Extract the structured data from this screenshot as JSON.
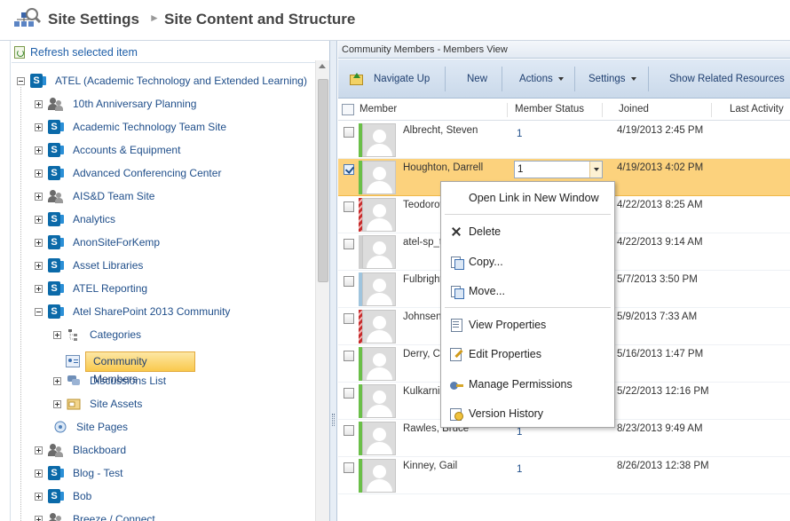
{
  "header": {
    "title": "Site Settings",
    "subtitle": "Site Content and Structure"
  },
  "left": {
    "refresh": "Refresh selected item",
    "root": "ATEL (Academic Technology and Extended Learning)",
    "sites": [
      {
        "label": "10th Anniversary Planning",
        "icon": "group-icon"
      },
      {
        "label": "Academic Technology Team Site",
        "icon": "sharepoint-icon"
      },
      {
        "label": "Accounts & Equipment",
        "icon": "sharepoint-icon"
      },
      {
        "label": "Advanced Conferencing Center",
        "icon": "sharepoint-icon"
      },
      {
        "label": "AIS&D Team Site",
        "icon": "group-icon"
      },
      {
        "label": "Analytics",
        "icon": "sharepoint-icon"
      },
      {
        "label": "AnonSiteForKemp",
        "icon": "sharepoint-icon"
      },
      {
        "label": "Asset Libraries",
        "icon": "sharepoint-icon"
      },
      {
        "label": "ATEL Reporting",
        "icon": "sharepoint-icon"
      },
      {
        "label": "Atel SharePoint 2013 Community",
        "icon": "sharepoint-icon"
      }
    ],
    "children": [
      {
        "label": "Categories",
        "icon": "categories-icon"
      },
      {
        "label": "Community Members",
        "icon": "members-list-icon"
      },
      {
        "label": "Discussions List",
        "icon": "discussion-icon"
      },
      {
        "label": "Site Assets",
        "icon": "assets-icon"
      },
      {
        "label": "Site Pages",
        "icon": "pages-icon"
      }
    ],
    "more_sites": [
      {
        "label": "Blackboard",
        "icon": "group-icon"
      },
      {
        "label": "Blog - Test",
        "icon": "sharepoint-icon"
      },
      {
        "label": "Bob",
        "icon": "sharepoint-icon"
      },
      {
        "label": "Breeze / Connect",
        "icon": "group-icon"
      }
    ]
  },
  "right": {
    "view_title": "Community Members - Members View",
    "toolbar": {
      "navigate_up": "Navigate Up",
      "new": "New",
      "actions": "Actions",
      "settings": "Settings",
      "related": "Show Related Resources"
    },
    "columns": {
      "member": "Member",
      "status": "Member Status",
      "joined": "Joined",
      "last_activity": "Last Activity"
    },
    "rows": [
      {
        "name": "Albrecht, Steven",
        "status": "1",
        "joined": "4/19/2013 2:45 PM",
        "stripe": "green"
      },
      {
        "name": "Houghton, Darrell",
        "status": "1",
        "joined": "4/19/2013 4:02 PM",
        "stripe": "green"
      },
      {
        "name": "Teodorov",
        "status": "",
        "joined": "4/22/2013 8:25 AM",
        "stripe": "red"
      },
      {
        "name": "atel-sp_t",
        "status": "",
        "joined": "4/22/2013 9:14 AM",
        "stripe": "gray"
      },
      {
        "name": "Fulbright",
        "status": "",
        "joined": "5/7/2013 3:50 PM",
        "stripe": "blue"
      },
      {
        "name": "Johnsen,",
        "status": "",
        "joined": "5/9/2013 7:33 AM",
        "stripe": "red"
      },
      {
        "name": "Derry, Cl",
        "status": "",
        "joined": "5/16/2013 1:47 PM",
        "stripe": "green"
      },
      {
        "name": "Kulkarni,",
        "status": "",
        "joined": "5/22/2013 12:16 PM",
        "stripe": "green"
      },
      {
        "name": "Rawles, Bruce",
        "status": "1",
        "joined": "8/23/2013 9:49 AM",
        "stripe": "green"
      },
      {
        "name": "Kinney, Gail",
        "status": "1",
        "joined": "8/26/2013 12:38 PM",
        "stripe": "green"
      }
    ],
    "edit_value": "1"
  },
  "menu": {
    "open_new": "Open Link in New Window",
    "delete": "Delete",
    "copy": "Copy...",
    "move": "Move...",
    "view_props": "View Properties",
    "edit_props": "Edit Properties",
    "manage_perms": "Manage Permissions",
    "version_history": "Version History"
  },
  "colors": {
    "selected_row": "#fcd27d",
    "link": "#1f4e8a",
    "sharepoint": "#0b6aa9"
  }
}
